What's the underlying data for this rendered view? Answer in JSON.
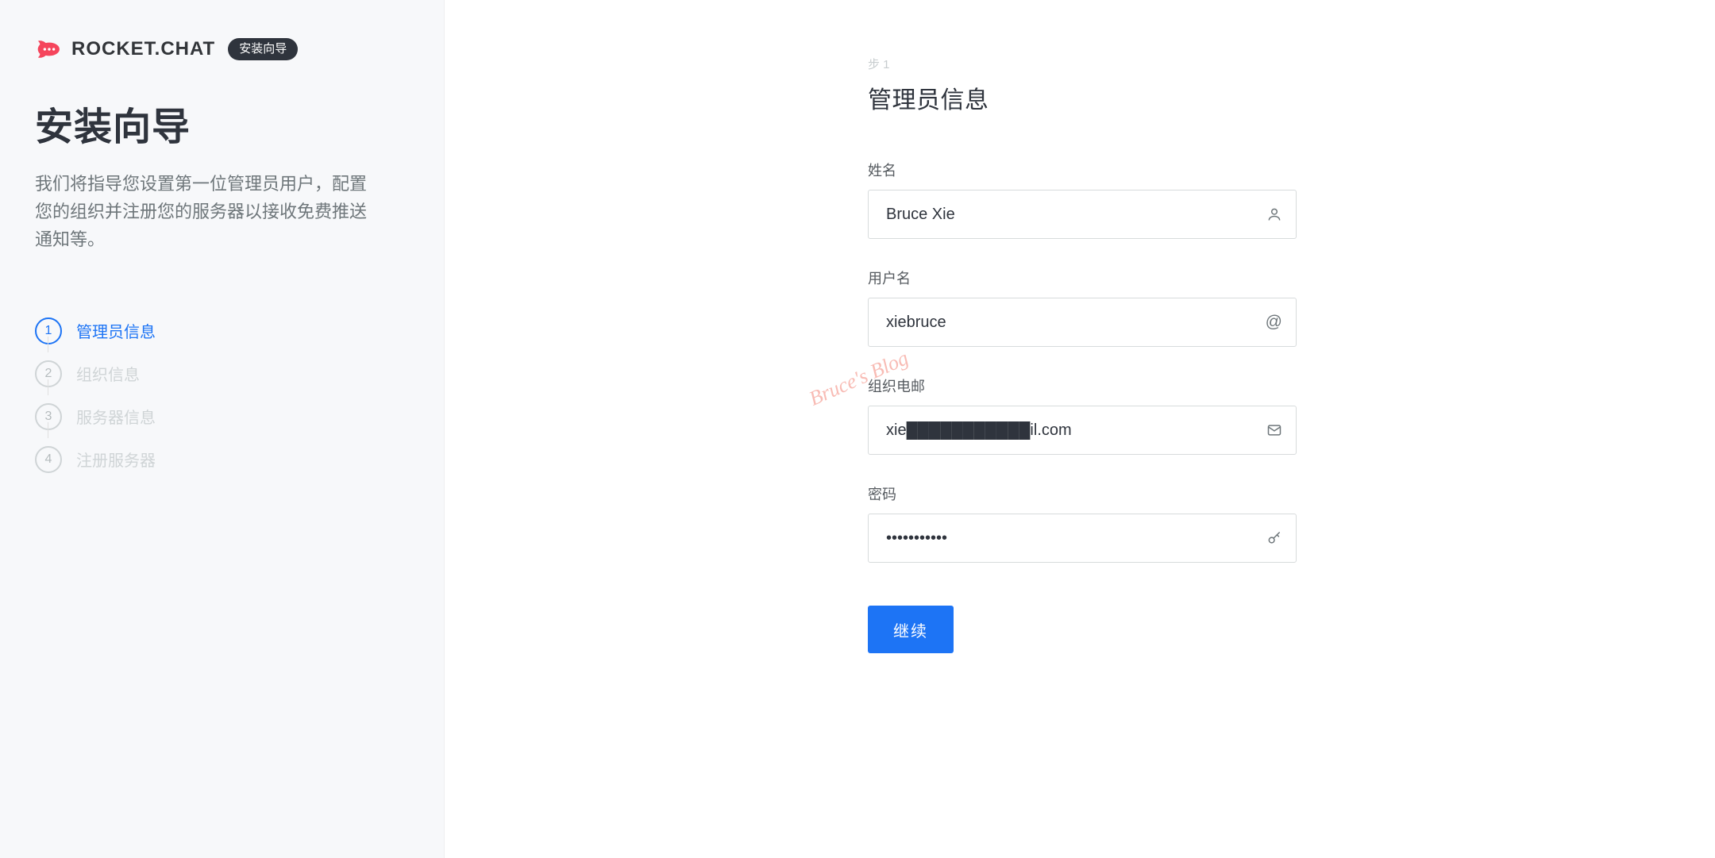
{
  "brand": {
    "name": "ROCKET.CHAT",
    "pill": "安装向导",
    "accent_color": "#f5455c",
    "primary_color": "#1d74f5"
  },
  "sidebar": {
    "title": "安装向导",
    "subtitle": "我们将指导您设置第一位管理员用户，配置您的组织并注册您的服务器以接收免费推送通知等。",
    "steps": [
      {
        "num": "1",
        "label": "管理员信息",
        "active": true
      },
      {
        "num": "2",
        "label": "组织信息",
        "active": false
      },
      {
        "num": "3",
        "label": "服务器信息",
        "active": false
      },
      {
        "num": "4",
        "label": "注册服务器",
        "active": false
      }
    ]
  },
  "form": {
    "step_indicator": "步  1",
    "title": "管理员信息",
    "fields": {
      "name": {
        "label": "姓名",
        "value": "Bruce Xie",
        "icon": "user-icon"
      },
      "username": {
        "label": "用户名",
        "value": "xiebruce",
        "icon": "at-icon"
      },
      "email": {
        "label": "组织电邮",
        "value": "xie███████████il.com",
        "icon": "mail-icon"
      },
      "password": {
        "label": "密码",
        "value": "•••••••••••",
        "icon": "key-icon"
      }
    },
    "submit_label": "继续"
  },
  "watermark": "Bruce's Blog"
}
